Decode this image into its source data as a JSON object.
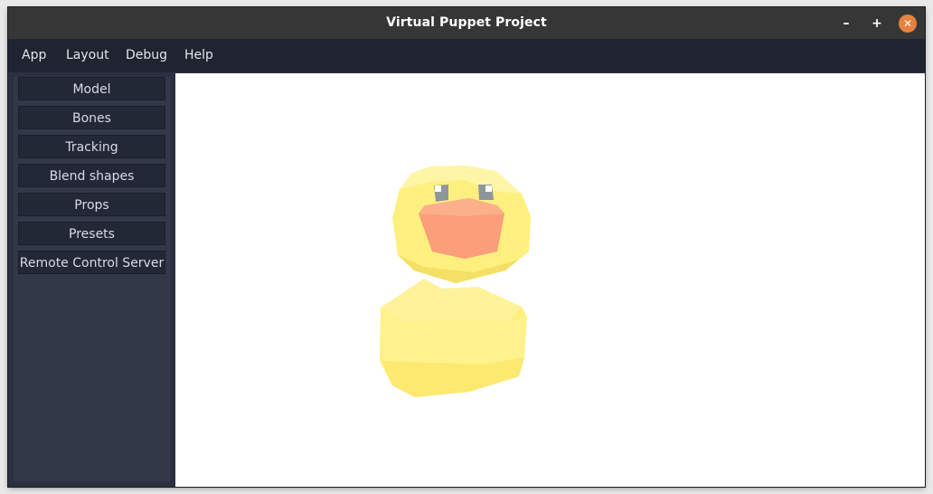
{
  "window": {
    "title": "Virtual Puppet Project",
    "controls": {
      "minimize": "–",
      "maximize": "+",
      "close": "✕"
    },
    "close_color": "#e8813b"
  },
  "menubar": {
    "items": [
      "App",
      "Layout",
      "Debug",
      "Help"
    ]
  },
  "sidebar": {
    "buttons": [
      "Model",
      "Bones",
      "Tracking",
      "Blend shapes",
      "Props",
      "Presets",
      "Remote Control Server"
    ]
  },
  "viewport": {
    "background": "#ffffff",
    "model": "duck-model"
  },
  "colors": {
    "titlebar": "#363636",
    "menubar": "#202330",
    "sidebar": "#333849",
    "duck_body": "#fdf07e",
    "duck_beak": "#fba781"
  }
}
